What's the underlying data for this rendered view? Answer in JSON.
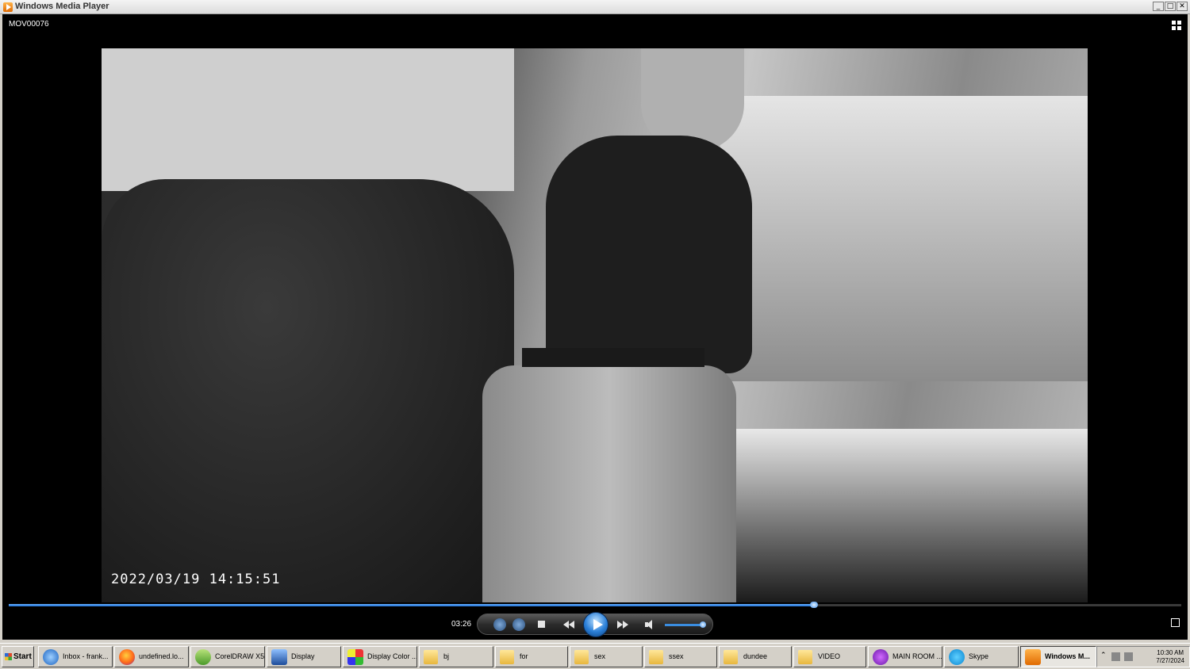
{
  "window": {
    "title": "Windows Media Player",
    "buttons": {
      "minimize": "_",
      "maximize": "□",
      "close": "✕"
    }
  },
  "player": {
    "now_playing": "MOV00076",
    "video_timestamp": "2022/03/19  14:15:51",
    "current_time": "03:26",
    "seek_progress": 0.687,
    "volume_level": 0.95,
    "accent_color": "#1c6fd6"
  },
  "taskbar": {
    "start_label": "Start",
    "items": [
      {
        "label": "Inbox - frank...",
        "icon": "mail-icon"
      },
      {
        "label": "undefined.lo...",
        "icon": "firefox-icon"
      },
      {
        "label": "CorelDRAW X5",
        "icon": "coreldraw-icon"
      },
      {
        "label": "Display",
        "icon": "display-icon"
      },
      {
        "label": "Display Color ...",
        "icon": "display-color-icon"
      },
      {
        "label": "bj",
        "icon": "folder-icon"
      },
      {
        "label": "for",
        "icon": "folder-icon"
      },
      {
        "label": "sex",
        "icon": "folder-icon"
      },
      {
        "label": "ssex",
        "icon": "folder-icon"
      },
      {
        "label": "dundee",
        "icon": "folder-icon"
      },
      {
        "label": "VIDEO",
        "icon": "folder-icon"
      },
      {
        "label": "MAIN ROOM ...",
        "icon": "mainroom-icon"
      },
      {
        "label": "Skype",
        "icon": "skype-icon"
      },
      {
        "label": "Windows M...",
        "icon": "wmp-icon",
        "active": true
      }
    ],
    "clock": {
      "time": "10:30 AM",
      "date": "7/27/2024"
    }
  }
}
